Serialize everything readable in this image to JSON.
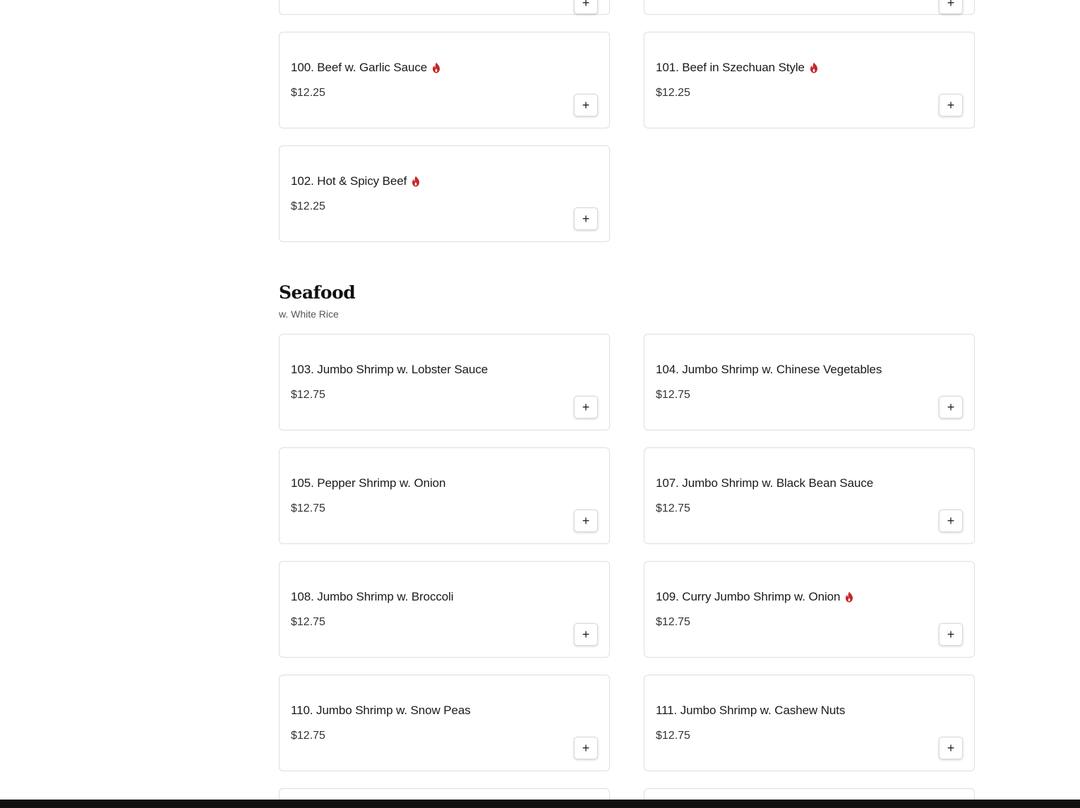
{
  "colors": {
    "accent_spicy": "#c62828",
    "card_border": "#dedede",
    "bottom_bar": "#111111"
  },
  "icons": {
    "spicy": "flame-icon",
    "add": "plus-icon"
  },
  "beef_items": [
    {
      "name": "100. Beef w. Garlic Sauce",
      "price": "$12.25",
      "spicy": true
    },
    {
      "name": "101. Beef in Szechuan Style",
      "price": "$12.25",
      "spicy": true
    },
    {
      "name": "102. Hot & Spicy Beef",
      "price": "$12.25",
      "spicy": true
    }
  ],
  "seafood": {
    "title": "Seafood",
    "subtitle": "w. White Rice",
    "items": [
      {
        "name": "103. Jumbo Shrimp w. Lobster Sauce",
        "price": "$12.75",
        "spicy": false
      },
      {
        "name": "104. Jumbo Shrimp w. Chinese Vegetables",
        "price": "$12.75",
        "spicy": false
      },
      {
        "name": "105. Pepper Shrimp w. Onion",
        "price": "$12.75",
        "spicy": false
      },
      {
        "name": "107. Jumbo Shrimp w. Black Bean Sauce",
        "price": "$12.75",
        "spicy": false
      },
      {
        "name": "108. Jumbo Shrimp w. Broccoli",
        "price": "$12.75",
        "spicy": false
      },
      {
        "name": "109. Curry Jumbo Shrimp w. Onion",
        "price": "$12.75",
        "spicy": true
      },
      {
        "name": "110. Jumbo Shrimp w. Snow Peas",
        "price": "$12.75",
        "spicy": false
      },
      {
        "name": "111. Jumbo Shrimp w. Cashew Nuts",
        "price": "$12.75",
        "spicy": false
      }
    ]
  },
  "add_button_label": "+"
}
